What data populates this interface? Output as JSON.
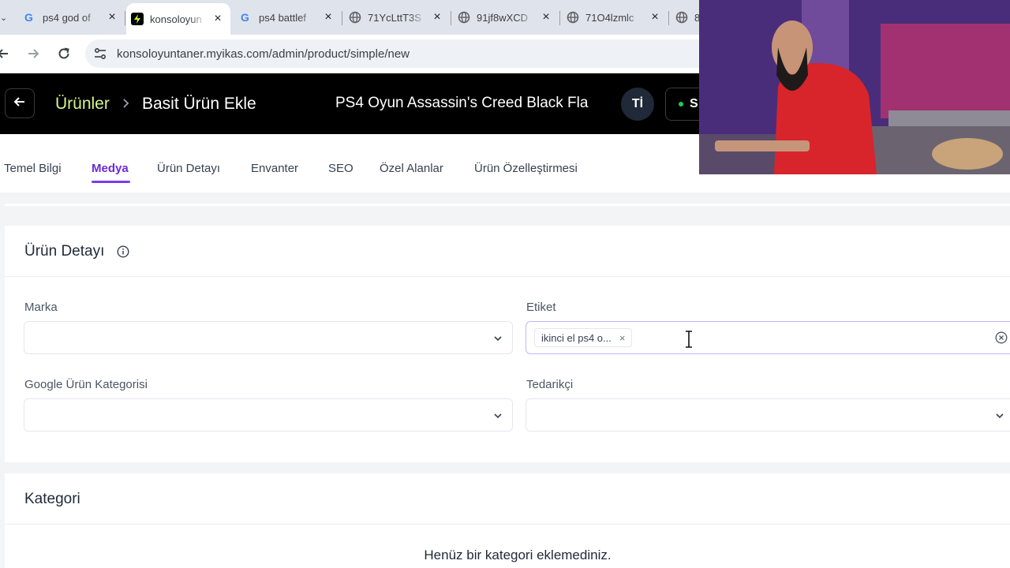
{
  "browser": {
    "tabs": [
      {
        "title": "ps4 god of",
        "favicon": "google-icon"
      },
      {
        "title": "konsoloyun",
        "favicon": "bolt-icon"
      },
      {
        "title": "ps4 battlef",
        "favicon": "google-icon"
      },
      {
        "title": "71YcLttT3S",
        "favicon": "globe-icon"
      },
      {
        "title": "91jf8wXCD",
        "favicon": "globe-icon"
      },
      {
        "title": "71O4lzmlc",
        "favicon": "globe-icon"
      },
      {
        "title": "8",
        "favicon": "globe-icon"
      }
    ],
    "active_tab": 1,
    "close_glyph": "×",
    "url": "konsoloyuntaner.myikas.com/admin/product/simple/new"
  },
  "header": {
    "breadcrumb_root": "Ürünler",
    "breadcrumb_current": "Basit Ürün Ekle",
    "product_title": "PS4 Oyun Assassin's Creed Black Fla",
    "avatar_initials": "Tİ",
    "status_label": "S",
    "status_color": "#22c55e"
  },
  "page_tabs": [
    "Temel Bilgi",
    "Medya",
    "Ürün Detayı",
    "Envanter",
    "SEO",
    "Özel Alanlar",
    "Ürün Özelleştirmesi"
  ],
  "active_page_tab": "Medya",
  "product_detail": {
    "title": "Ürün Detayı",
    "brand_label": "Marka",
    "brand_value": "",
    "tag_label": "Etiket",
    "tag_chips": [
      "ikinci el ps4 o..."
    ],
    "google_category_label": "Google Ürün Kategorisi",
    "supplier_label": "Tedarikçi"
  },
  "category": {
    "title": "Kategori",
    "empty_message": "Henüz bir kategori eklemediniz."
  },
  "colors": {
    "accent": "#6d28d9",
    "breadcrumb_highlight": "#d7f58c",
    "header_bg": "#000000"
  }
}
